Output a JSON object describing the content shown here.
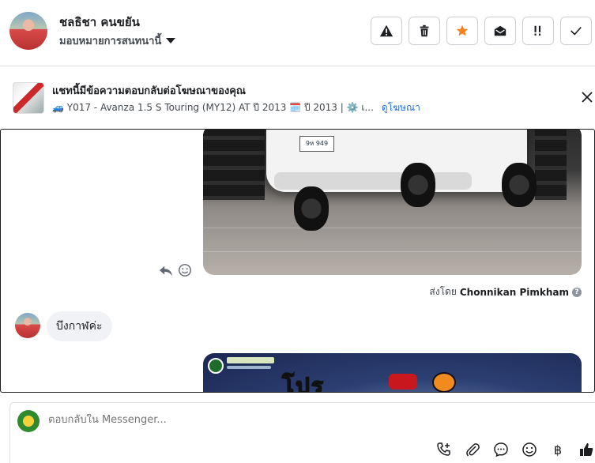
{
  "header": {
    "user_name": "ชลธิชา คนขยัน",
    "assign_label": "มอบหมายการสนทนานี้",
    "tools": [
      {
        "name": "report-icon"
      },
      {
        "name": "trash-icon"
      },
      {
        "name": "star-icon",
        "color": "#f5821f"
      },
      {
        "name": "mark-unread-icon"
      },
      {
        "name": "priority-icon"
      },
      {
        "name": "check-icon"
      }
    ]
  },
  "ad": {
    "title": "แชทนี้มีข้อความตอบกลับต่อโฆษณาของคุณ",
    "subtitle": "🚙 Y017 - Avanza 1.5 S Touring (MY12) AT ปี 2013 🗓️ ปี 2013 | ⚙️ เ...",
    "link": "ดูโฆษณา"
  },
  "chat": {
    "plate_text": "9ห 949",
    "sent_by_prefix": "ส่งโดย",
    "sent_by_name": "Chonnikan Pimkham",
    "help": "?",
    "customer_message": "บึงกาฬค่ะ",
    "promo_title": "โปร"
  },
  "composer": {
    "placeholder": "ตอบกลับใน Messenger...",
    "baht_symbol": "฿"
  },
  "colors": {
    "link": "#216fdb",
    "accent": "#f5821f",
    "bubble": "#f0f2f5"
  }
}
